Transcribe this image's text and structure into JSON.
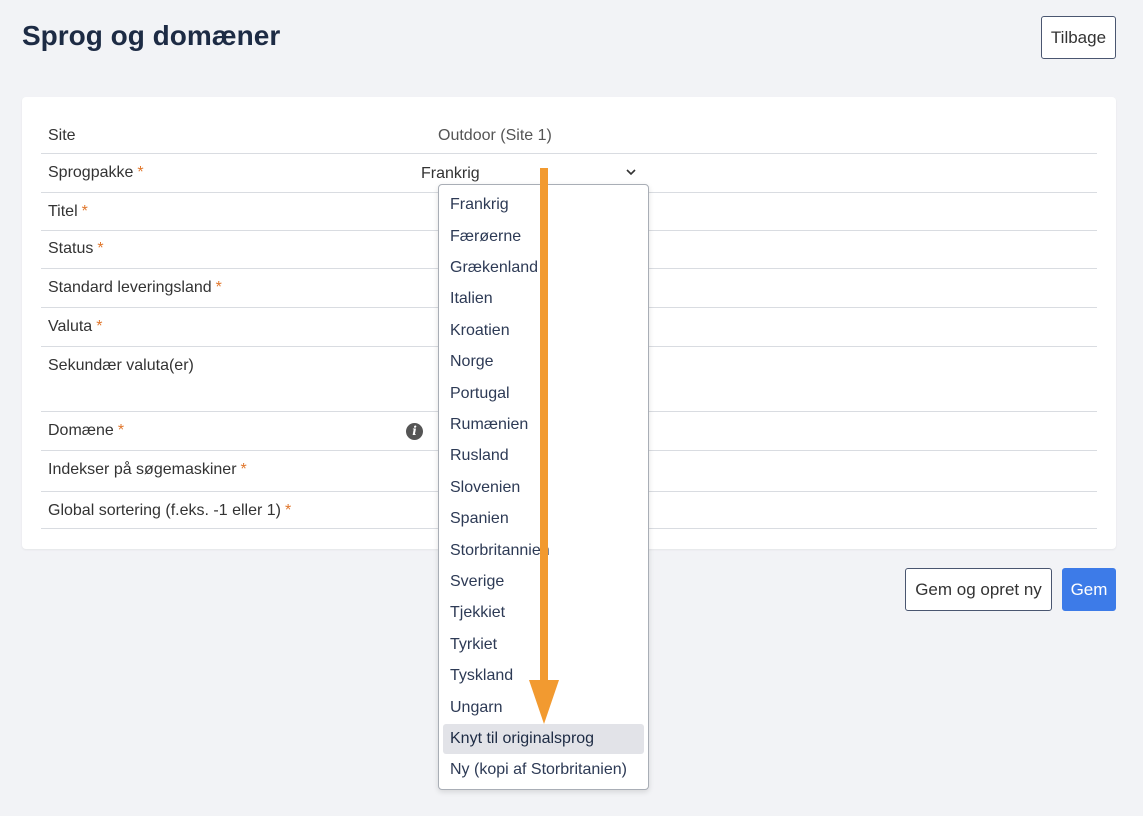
{
  "header": {
    "title": "Sprog og domæner",
    "back_label": "Tilbage"
  },
  "form": {
    "required_marker": "*",
    "rows": [
      {
        "label": "Site",
        "value": "Outdoor (Site 1)"
      },
      {
        "label": "Sprogpakke"
      },
      {
        "label": "Titel"
      },
      {
        "label": "Status"
      },
      {
        "label": "Standard leveringsland"
      },
      {
        "label": "Valuta"
      },
      {
        "label": "Sekundær valuta(er)"
      },
      {
        "label": "Domæne"
      },
      {
        "label": "Indekser på søgemaskiner"
      },
      {
        "label": "Global sortering (f.eks. -1 eller 1)"
      }
    ],
    "language_select": {
      "selected": "Frankrig",
      "options": [
        "Frankrig",
        "Færøerne",
        "Grækenland",
        "Italien",
        "Kroatien",
        "Norge",
        "Portugal",
        "Rumænien",
        "Rusland",
        "Slovenien",
        "Spanien",
        "Storbritannien",
        "Sverige",
        "Tjekkiet",
        "Tyrkiet",
        "Tyskland",
        "Ungarn",
        "Knyt til originalsprog",
        "Ny (kopi af Storbritanien)"
      ],
      "highlighted": "Knyt til originalsprog"
    }
  },
  "footer": {
    "save_new_label": "Gem og opret ny",
    "save_label": "Gem"
  },
  "colors": {
    "required": "#e0762b",
    "primary": "#3d7be8",
    "annotation_arrow": "#f29a30"
  },
  "icons": {
    "info": "info-icon",
    "chevron": "chevron-down-icon"
  }
}
